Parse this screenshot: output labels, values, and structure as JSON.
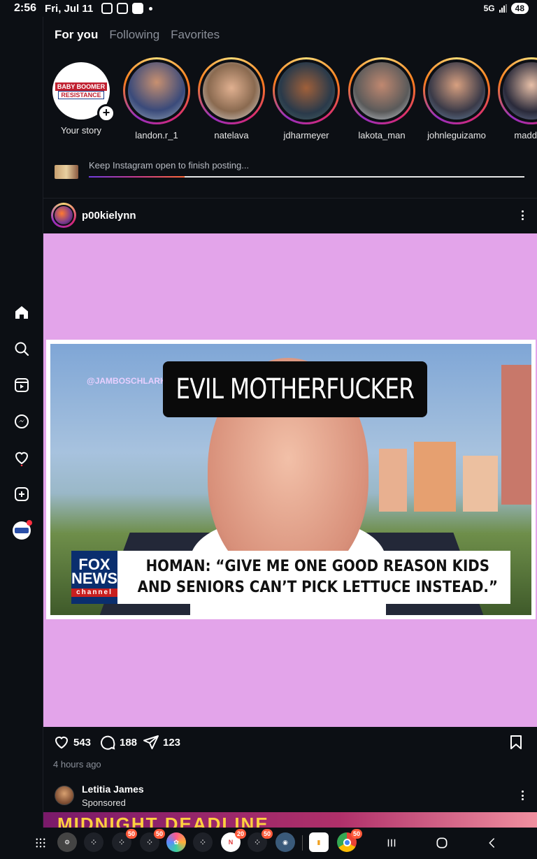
{
  "status_bar": {
    "time": "2:56",
    "date": "Fri, Jul 11",
    "network": "5G",
    "battery": "48"
  },
  "tabs": [
    {
      "label": "For you",
      "active": true
    },
    {
      "label": "Following",
      "active": false
    },
    {
      "label": "Favorites",
      "active": false
    }
  ],
  "stories": [
    {
      "username": "Your story",
      "own": true,
      "pic_text_1": "BABY BOOMER",
      "pic_text_2": "RESISTANCE"
    },
    {
      "username": "landon.r_1"
    },
    {
      "username": "natelava"
    },
    {
      "username": "jdharmeyer"
    },
    {
      "username": "lakota_man"
    },
    {
      "username": "johnleguizamo"
    },
    {
      "username": "maddow"
    }
  ],
  "upload": {
    "text": "Keep Instagram open to finish posting...",
    "progress": 0.22
  },
  "post": {
    "username": "p00kielynn",
    "watermark": "@JAMBOSCHLARK",
    "caption_overlay": "EVIL MOTHERFUCKER",
    "network_logo_line1": "FOX",
    "network_logo_line2": "NEWS",
    "network_logo_line3": "channel",
    "headline_line1": "HOMAN: “GIVE ME ONE GOOD REASON KIDS",
    "headline_line2": "AND SENIORS CAN’T PICK LETTUCE INSTEAD.”",
    "likes": "543",
    "comments": "188",
    "shares": "123",
    "time_ago": "4 hours ago"
  },
  "sponsored": {
    "name": "Letitia James",
    "label": "Sponsored",
    "ad_text": "MIDNIGHT DEADLINE"
  },
  "taskbar": {
    "badges": [
      "50",
      "50",
      "20",
      "50",
      "50"
    ]
  },
  "colors": {
    "background": "#0c0f14",
    "post_backdrop": "#e3a4ea",
    "notification_red": "#ff3040"
  }
}
